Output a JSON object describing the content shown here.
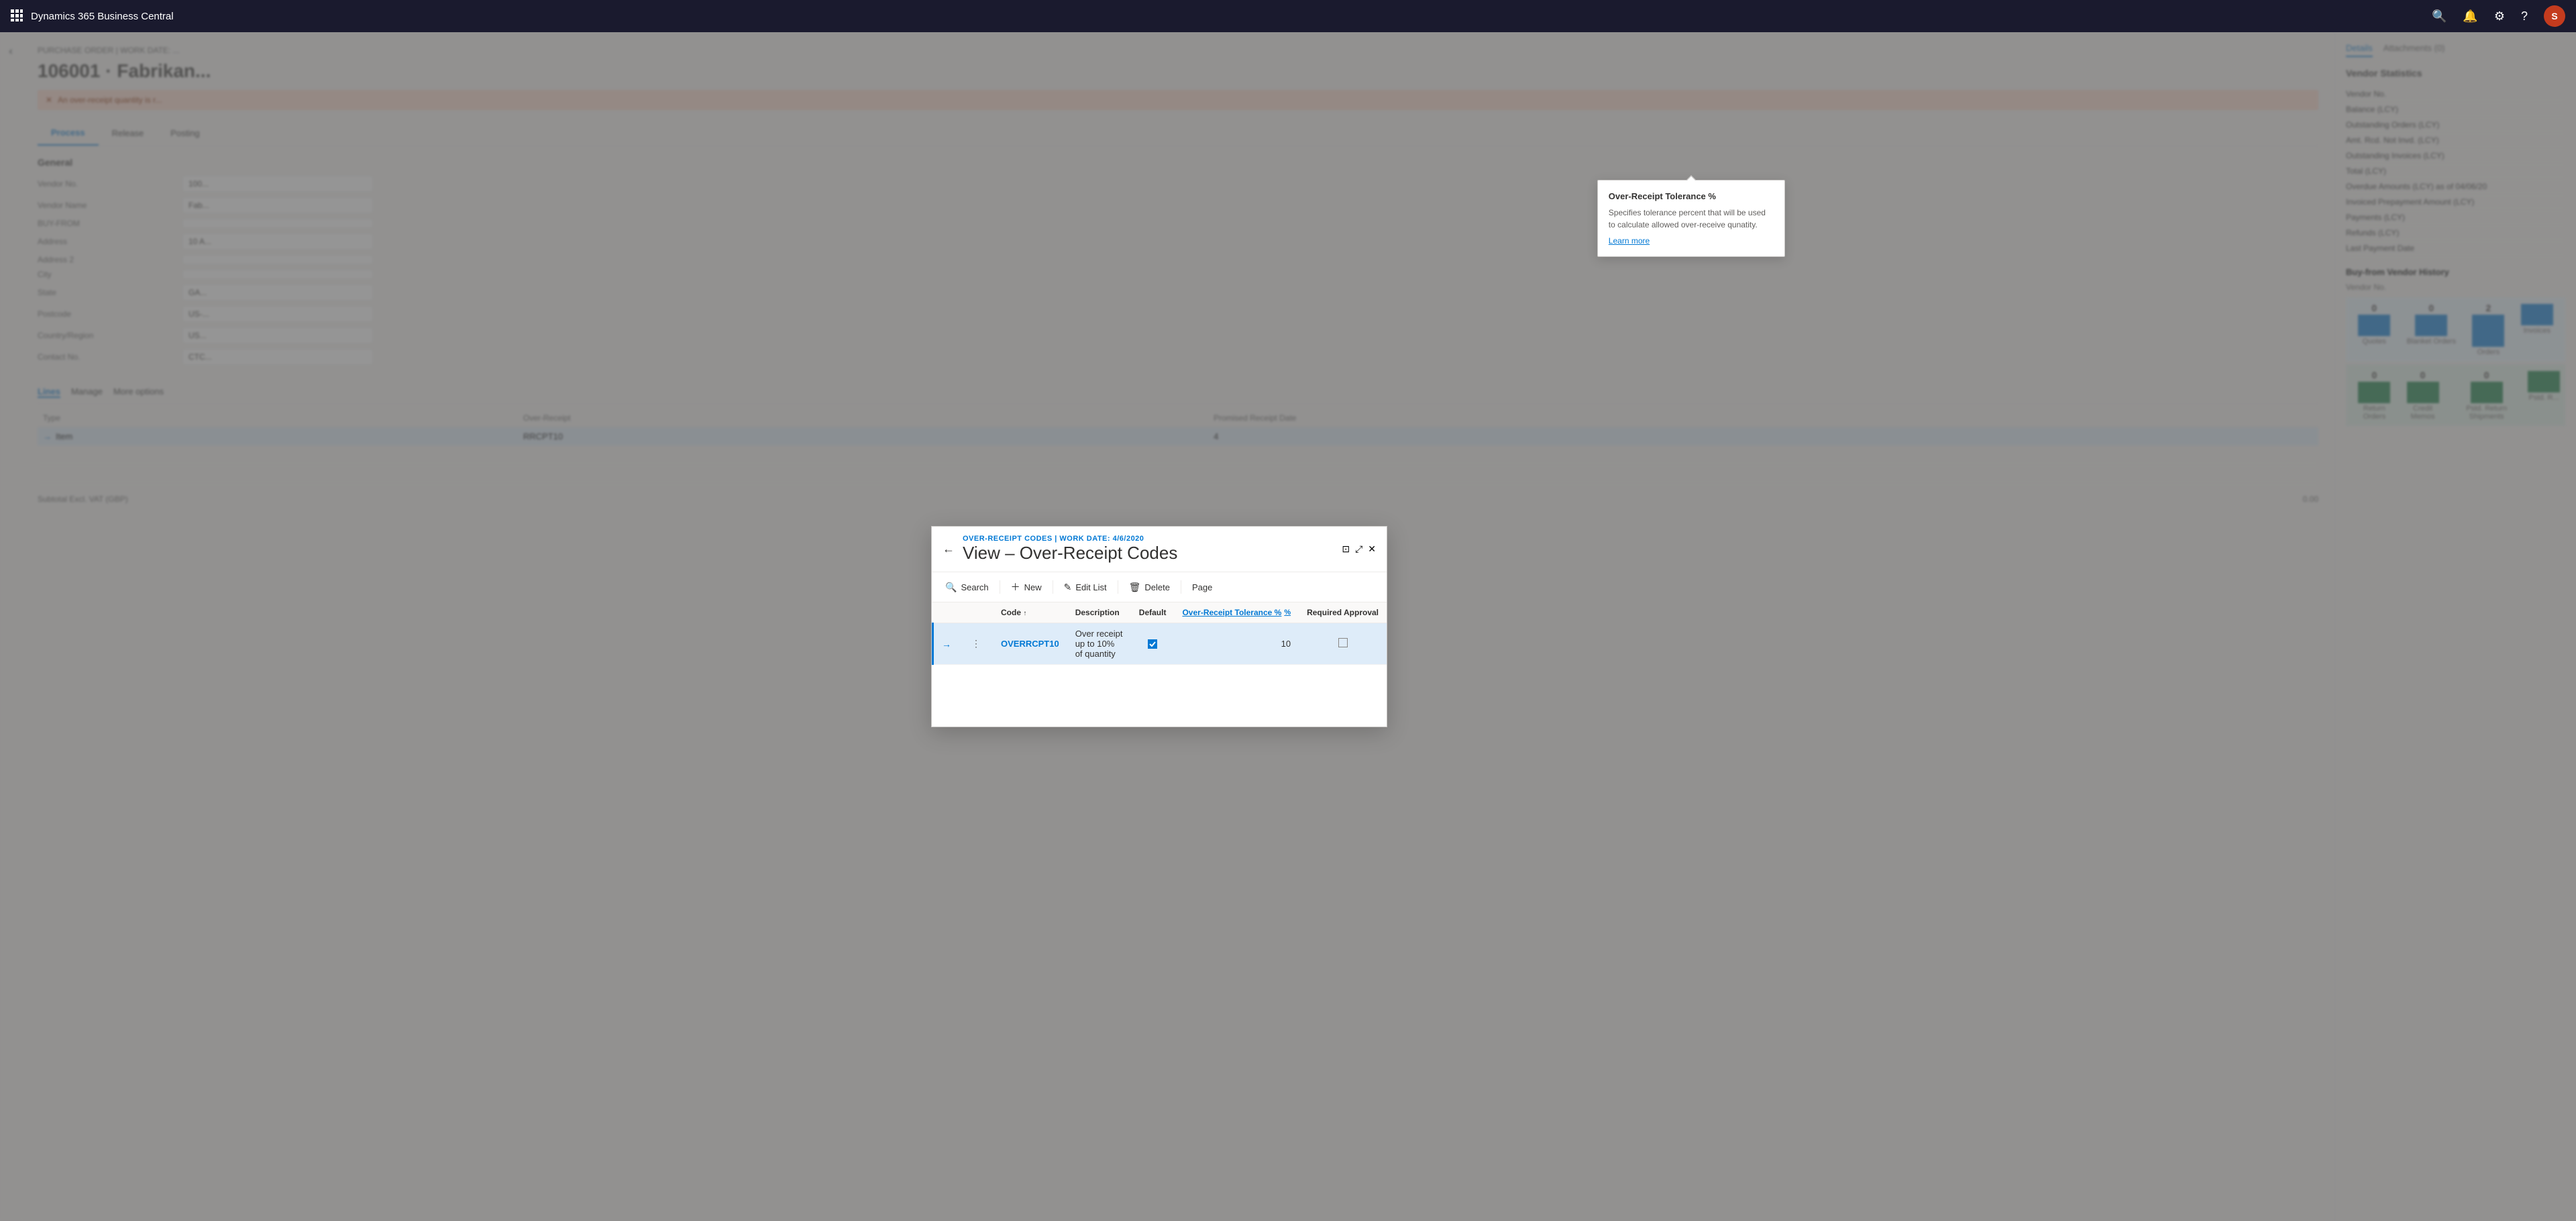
{
  "app": {
    "title": "Dynamics 365 Business Central",
    "nav_icons": [
      "search",
      "bell",
      "settings",
      "help"
    ],
    "user_initials": "S"
  },
  "background_page": {
    "breadcrumb": "PURCHASE ORDER | WORK DATE: ...",
    "title": "106001 · Fabrikan...",
    "warning": "An over-receipt quantity is r...",
    "tabs": [
      "Process",
      "Release",
      "Posting"
    ],
    "active_tab": "Process",
    "general_section": "General",
    "form_fields": [
      {
        "label": "Vendor No.",
        "value": "100..."
      },
      {
        "label": "Vendor Name",
        "value": "Fab..."
      },
      {
        "label": "BUY-FROM",
        "value": ""
      },
      {
        "label": "Address",
        "value": "10 A..."
      },
      {
        "label": "Address 2",
        "value": ""
      },
      {
        "label": "City",
        "value": ""
      },
      {
        "label": "State",
        "value": "GA..."
      },
      {
        "label": "Postcode",
        "value": "US-..."
      },
      {
        "label": "Country/Region",
        "value": "US..."
      },
      {
        "label": "Contact No.",
        "value": "CTC..."
      }
    ],
    "lines_section": {
      "tabs": [
        "Lines",
        "Manage",
        "More options"
      ],
      "columns": [
        "Type"
      ],
      "rows": [
        {
          "type": "Item",
          "over_receipt": "RRCPT10",
          "value": "4"
        }
      ]
    },
    "subtotal": "Subtotal Excl. VAT (GBP)",
    "subtotal_value": "0.00"
  },
  "right_panel": {
    "tabs": [
      "Details",
      "Attachments (0)"
    ],
    "active_tab": "Details",
    "vendor_stats_title": "Vendor Statistics",
    "stats": [
      {
        "label": "Vendor No.",
        "value": ""
      },
      {
        "label": "Balance (LCY)",
        "value": ""
      },
      {
        "label": "Outstanding Orders (LCY)",
        "value": ""
      },
      {
        "label": "Amt. Rcd. Not Invd. (LCY)",
        "value": ""
      },
      {
        "label": "Outstanding Invoices (LCY)",
        "value": ""
      },
      {
        "label": "Total (LCY)",
        "value": ""
      },
      {
        "label": "Overdue Amounts (LCY) as of 04/06/20",
        "value": ""
      },
      {
        "label": "Invoiced Prepayment Amount (LCY)",
        "value": ""
      },
      {
        "label": "Payments (LCY)",
        "value": ""
      },
      {
        "label": "Refunds (LCY)",
        "value": ""
      },
      {
        "label": "Last Payment Date",
        "value": ""
      }
    ],
    "buy_from_title": "Buy-from Vendor History",
    "buy_from_vendor_no_label": "Vendor No.",
    "chart": {
      "top_bars": [
        {
          "label": "Quotes",
          "value": "0",
          "height": 40
        },
        {
          "label": "Blanket Orders",
          "value": "0",
          "height": 40
        },
        {
          "label": "Orders",
          "value": "2",
          "height": 60
        },
        {
          "label": "Invoices",
          "value": "",
          "height": 40
        }
      ],
      "bottom_bars": [
        {
          "label": "Return Orders",
          "value": "0",
          "height": 40
        },
        {
          "label": "Credit Memos",
          "value": "0",
          "height": 40
        },
        {
          "label": "Pstd. Return Shipments",
          "value": "0",
          "height": 40
        },
        {
          "label": "Pstd. R...",
          "value": "",
          "height": 40
        }
      ]
    }
  },
  "modal": {
    "breadcrumb": "OVER-RECEIPT CODES | WORK DATE: 4/6/2020",
    "title": "View – Over-Receipt Codes",
    "toolbar": {
      "search_label": "Search",
      "new_label": "New",
      "edit_list_label": "Edit List",
      "delete_label": "Delete",
      "page_label": "Page"
    },
    "table": {
      "columns": [
        {
          "key": "code",
          "label": "Code",
          "sortable": true
        },
        {
          "key": "description",
          "label": "Description",
          "sortable": false
        },
        {
          "key": "default",
          "label": "Default",
          "sortable": false
        },
        {
          "key": "tolerance",
          "label": "Over-Receipt Tolerance %",
          "sortable": false,
          "link": true
        },
        {
          "key": "required_approval",
          "label": "Required Approval",
          "sortable": false
        }
      ],
      "rows": [
        {
          "code": "OVERRCPT10",
          "description": "Over receipt up to 10% of quantity",
          "default": true,
          "tolerance": "10",
          "required_approval": false,
          "selected": true
        }
      ]
    }
  },
  "tooltip": {
    "title": "Over-Receipt Tolerance %",
    "body": "Specifies tolerance percent that will be used to calculate allowed over-receive qunatity.",
    "link": "Learn more"
  }
}
